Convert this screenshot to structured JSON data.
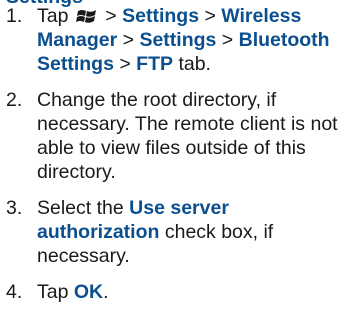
{
  "cut_heading": "Settings",
  "steps": [
    {
      "number": "1.",
      "parts": {
        "tap": "Tap",
        "start_icon": "windows-start-icon",
        "sep1": ">",
        "settings1": "Settings",
        "sep2": ">",
        "wireless_manager": "Wireless Manager",
        "sep3": ">",
        "settings2": "Settings",
        "sep4": ">",
        "bluetooth_settings": "Bluetooth Settings",
        "sep5": ">",
        "ftp": "FTP",
        "tail": "tab."
      }
    },
    {
      "number": "2.",
      "text": "Change the root directory, if necessary. The remote client is not able to view files outside of this directory."
    },
    {
      "number": "3.",
      "parts": {
        "select": "Select the",
        "use_server_authorization": "Use server authorization",
        "tail": "check box, if necessary."
      }
    },
    {
      "number": "4.",
      "parts": {
        "tap": "Tap",
        "ok": "OK",
        "tail": "."
      }
    }
  ],
  "colors": {
    "keyword": "#0b4f8f",
    "text": "#1a1a1a"
  }
}
